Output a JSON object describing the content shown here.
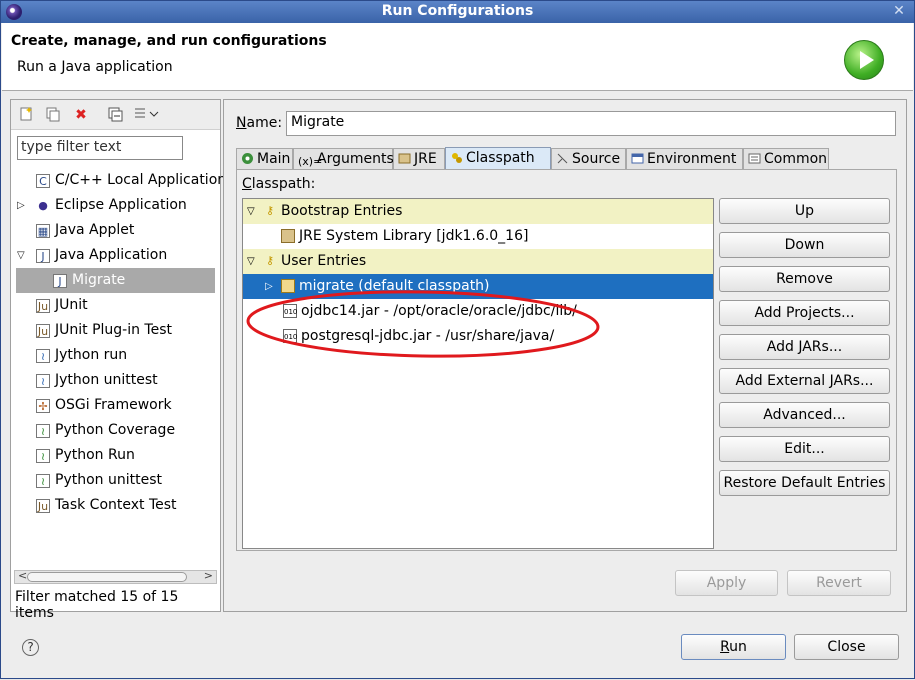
{
  "window": {
    "title": "Run Configurations",
    "close_glyph": "✕"
  },
  "header": {
    "title": "Create, manage, and run configurations",
    "subtitle": "Run a Java application"
  },
  "left": {
    "filter_placeholder": "type filter text",
    "toolbar": [
      "new-config-icon",
      "duplicate-icon",
      "delete-icon",
      "collapse-all-icon",
      "filter-icon"
    ],
    "tree": [
      {
        "label": "C/C++ Local Application",
        "icon": "c-app-icon",
        "indent": 1,
        "expander": ""
      },
      {
        "label": "Eclipse Application",
        "icon": "eclipse-icon",
        "indent": 0,
        "expander": "▷"
      },
      {
        "label": "Java Applet",
        "icon": "applet-icon",
        "indent": 1,
        "expander": ""
      },
      {
        "label": "Java Application",
        "icon": "java-app-icon",
        "indent": 0,
        "expander": "▽"
      },
      {
        "label": "Migrate",
        "icon": "java-app-icon",
        "indent": 2,
        "expander": "",
        "selected": true
      },
      {
        "label": "JUnit",
        "icon": "junit-icon",
        "indent": 1,
        "expander": ""
      },
      {
        "label": "JUnit Plug-in Test",
        "icon": "junit-plugin-icon",
        "indent": 1,
        "expander": ""
      },
      {
        "label": "Jython run",
        "icon": "jython-icon",
        "indent": 1,
        "expander": ""
      },
      {
        "label": "Jython unittest",
        "icon": "jython-unittest-icon",
        "indent": 1,
        "expander": ""
      },
      {
        "label": "OSGi Framework",
        "icon": "osgi-icon",
        "indent": 1,
        "expander": ""
      },
      {
        "label": "Python Coverage",
        "icon": "python-coverage-icon",
        "indent": 1,
        "expander": ""
      },
      {
        "label": "Python Run",
        "icon": "python-run-icon",
        "indent": 1,
        "expander": ""
      },
      {
        "label": "Python unittest",
        "icon": "python-unittest-icon",
        "indent": 1,
        "expander": ""
      },
      {
        "label": "Task Context Test",
        "icon": "task-context-icon",
        "indent": 1,
        "expander": ""
      }
    ],
    "filter_status": "Filter matched 15 of 15 items"
  },
  "name": {
    "label": "Name:",
    "value": "Migrate"
  },
  "tabs": [
    {
      "label": "Main",
      "icon": "main-tab-icon"
    },
    {
      "label": "Arguments",
      "icon": "arguments-tab-icon"
    },
    {
      "label": "JRE",
      "icon": "jre-tab-icon"
    },
    {
      "label": "Classpath",
      "icon": "classpath-tab-icon",
      "active": true
    },
    {
      "label": "Source",
      "icon": "source-tab-icon"
    },
    {
      "label": "Environment",
      "icon": "environment-tab-icon"
    },
    {
      "label": "Common",
      "icon": "common-tab-icon"
    }
  ],
  "classpath": {
    "label": "Classpath:",
    "entries": [
      {
        "label": "Bootstrap Entries",
        "type": "group",
        "expander": "▽",
        "icon": "bootstrap-entries-icon"
      },
      {
        "label": "JRE System Library [jdk1.6.0_16]",
        "type": "item",
        "expander": "",
        "icon": "library-icon"
      },
      {
        "label": "User Entries",
        "type": "group",
        "expander": "▽",
        "icon": "user-entries-icon"
      },
      {
        "label": "migrate (default classpath)",
        "type": "selected",
        "expander": "▷",
        "icon": "project-icon"
      },
      {
        "label": "ojdbc14.jar - /opt/oracle/oracle/jdbc/lib/",
        "type": "jar",
        "expander": "",
        "icon": "jar-icon"
      },
      {
        "label": "postgresql-jdbc.jar - /usr/share/java/",
        "type": "jar",
        "expander": "",
        "icon": "jar-icon"
      }
    ],
    "annotation_color": "#e0191d"
  },
  "side_buttons": [
    "Up",
    "Down",
    "Remove",
    "Add Projects...",
    "Add JARs...",
    "Add External JARs...",
    "Advanced...",
    "Edit...",
    "Restore Default Entries"
  ],
  "apply": "Apply",
  "revert": "Revert",
  "run": "Run",
  "close": "Close",
  "help": "?"
}
